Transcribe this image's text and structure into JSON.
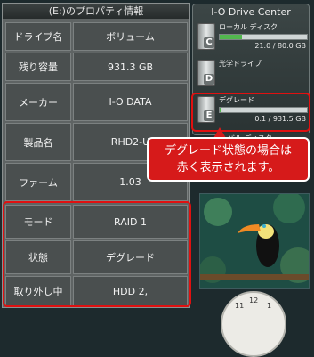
{
  "properties": {
    "title": "(E:)のプロパティ情報",
    "rows": [
      {
        "label": "ドライブ名",
        "value": "ボリューム"
      },
      {
        "label": "残り容量",
        "value": "931.3 GB"
      },
      {
        "label": "メーカー",
        "value": "I-O DATA"
      },
      {
        "label": "製品名",
        "value": "RHD2-U"
      },
      {
        "label": "ファーム",
        "value": "1.03"
      },
      {
        "label": "モード",
        "value": "RAID 1"
      },
      {
        "label": "状態",
        "value": "デグレード"
      },
      {
        "label": "取り外し中",
        "value": "HDD 2,"
      }
    ]
  },
  "gadget": {
    "title": "I-O Drive Center",
    "drives": [
      {
        "name": "ローカル ディスク",
        "letter": "C",
        "capacity": "21.0 / 80.0 GB",
        "fill_percent": 26,
        "bar_color": "#52b84e"
      },
      {
        "name": "光学ドライブ",
        "letter": "D",
        "capacity": "",
        "fill_percent": 0,
        "bar_color": "#52b84e"
      },
      {
        "name": "デグレード",
        "letter": "E",
        "capacity": "0.1 / 931.5 GB",
        "fill_percent": 1,
        "bar_color": "#52b84e"
      },
      {
        "name": "ーバル ディスク",
        "letter": "",
        "capacity": "",
        "fill_percent": 0,
        "bar_color": "#52b84e"
      }
    ]
  },
  "callout": {
    "line1": "デグレード状態の場合は",
    "line2": "赤く表示されます。"
  },
  "clock": {
    "numerals": [
      "11",
      "12",
      "1"
    ]
  },
  "colors": {
    "highlight": "#e01010",
    "callout_bg": "#d61a1a",
    "bar_green": "#52b84e"
  }
}
